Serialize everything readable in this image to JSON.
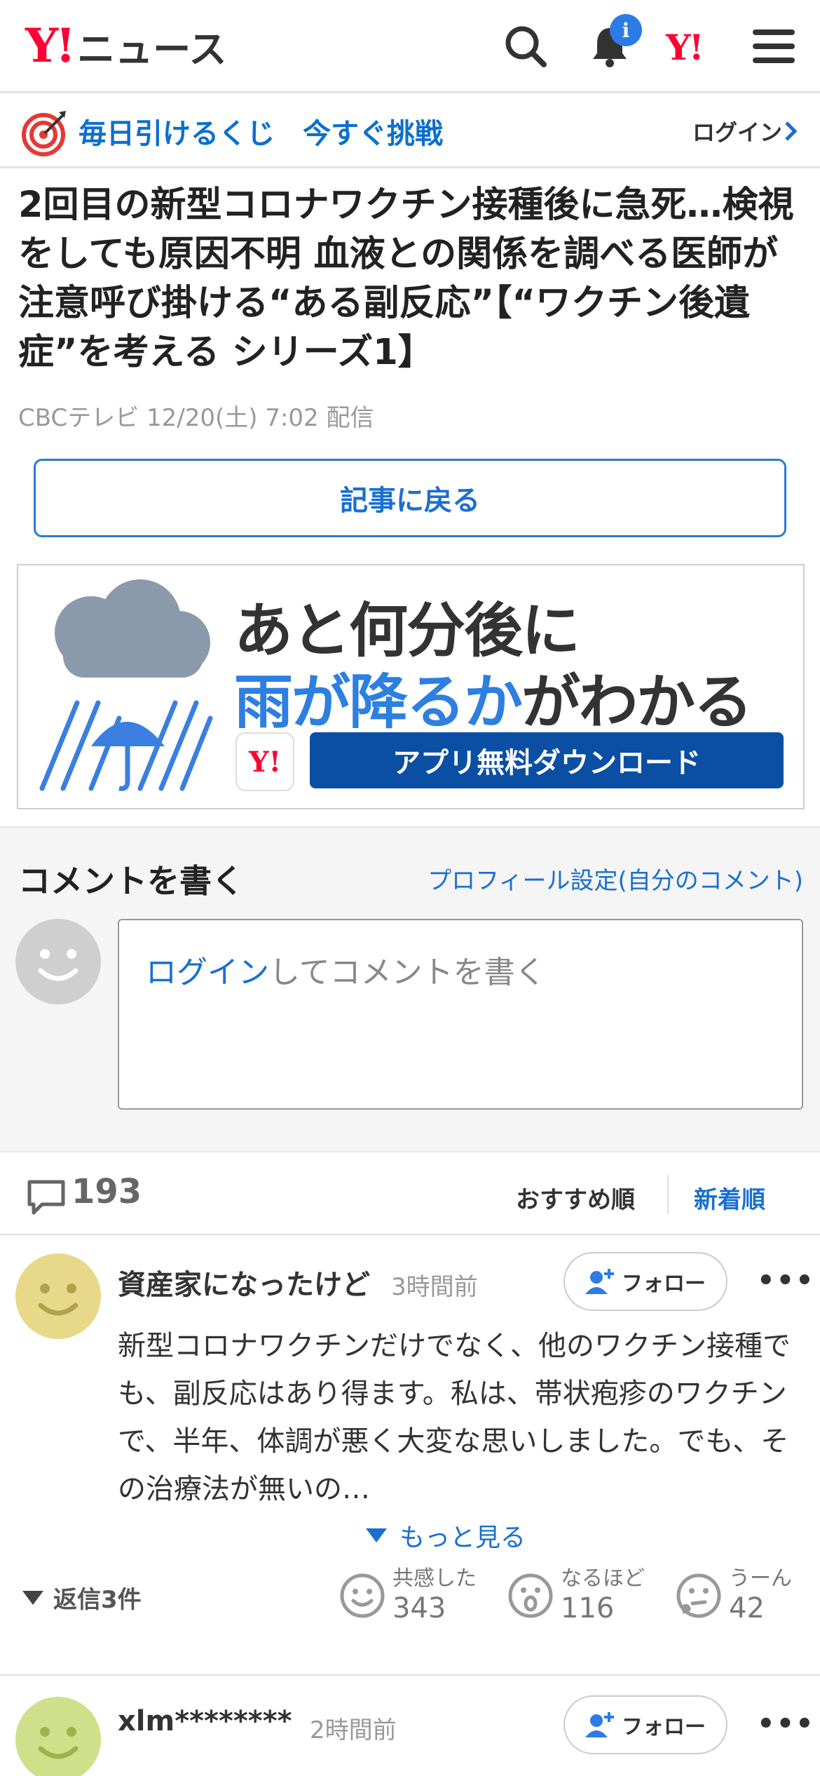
{
  "header": {
    "logo_y": "Y!",
    "logo_text": "ニュース",
    "notification_badge": "i",
    "yahoo_mark": "Y!"
  },
  "lottery": {
    "text": "毎日引けるくじ　今すぐ挑戦",
    "login": "ログイン"
  },
  "article": {
    "title": "2回目の新型コロナワクチン接種後に急死…検視をしても原因不明 血液との関係を調べる医師が注意呼び掛ける“ある副反応”【“ワクチン後遺症”を考える シリーズ1】",
    "meta": "CBCテレビ 12/20(土) 7:02 配信",
    "back_button": "記事に戻る"
  },
  "ad": {
    "line1": "あと何分後に",
    "line2_blue": "雨が降るか",
    "line2_rest": "がわかる",
    "logo": "Y!",
    "cta": "アプリ無料ダウンロード"
  },
  "comment_form": {
    "title": "コメントを書く",
    "profile_link": "プロフィール設定(自分のコメント)",
    "placeholder_link": "ログイン",
    "placeholder_rest": "してコメントを書く"
  },
  "sort": {
    "count": "193",
    "recommended": "おすすめ順",
    "newest": "新着順"
  },
  "comments": [
    {
      "user": "資産家になったけど",
      "time": "3時間前",
      "follow": "フォロー",
      "body": "新型コロナワクチンだけでなく、他のワクチン接種でも、副反応はあり得ます。私は、帯状疱疹のワクチンで、半年、体調が悪く大変な思いしました。でも、その治療法が無いの…",
      "see_more": "もっと見る",
      "replies": "返信3件",
      "reactions": [
        {
          "label": "共感した",
          "count": "343"
        },
        {
          "label": "なるほど",
          "count": "116"
        },
        {
          "label": "うーん",
          "count": "42"
        }
      ],
      "avatar_color": "#e8d98a"
    },
    {
      "user": "xlm********",
      "time": "2時間前",
      "follow": "フォロー",
      "avatar_color": "#cfe08a"
    }
  ]
}
